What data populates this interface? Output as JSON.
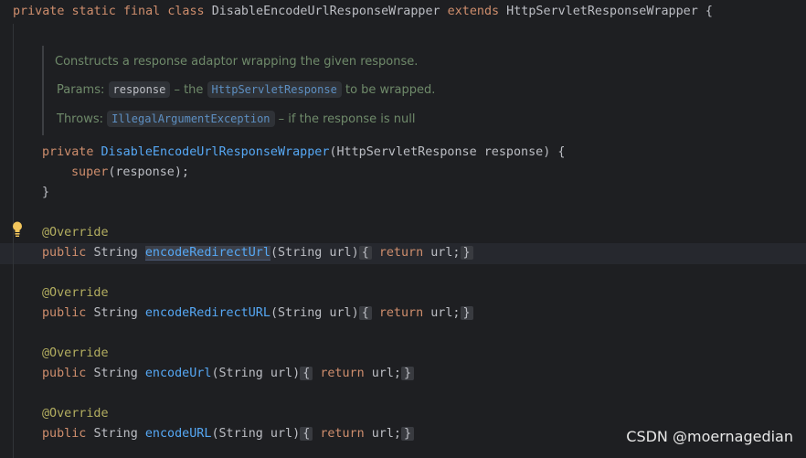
{
  "code": {
    "class_decl": {
      "private": "private",
      "static": "static",
      "final": "final",
      "class": "class",
      "name": "DisableEncodeUrlResponseWrapper",
      "extends": "extends",
      "parent": "HttpServletResponseWrapper",
      "brace": "{"
    },
    "javadoc": {
      "summary": "Constructs a response adaptor wrapping the given response.",
      "params_label": "Params:",
      "param_name": "response",
      "param_dash": "– the",
      "param_type": "HttpServletResponse",
      "param_tail": "to be wrapped.",
      "throws_label": "Throws:",
      "throws_type": "IllegalArgumentException",
      "throws_tail": "– if the response is null"
    },
    "constructor": {
      "modifier": "private",
      "name": "DisableEncodeUrlResponseWrapper",
      "params_open": "(HttpServletResponse response) {",
      "super_kw": "super",
      "super_args": "(response);",
      "close": "}"
    },
    "methods": [
      {
        "annotation": "@Override",
        "modifier": "public",
        "type": "String",
        "name": "encodeRedirectUrl",
        "params": "(String url)",
        "fold_open": "{",
        "return_kw": "return",
        "body": "url;",
        "fold_close": "}"
      },
      {
        "annotation": "@Override",
        "modifier": "public",
        "type": "String",
        "name": "encodeRedirectURL",
        "params": "(String url)",
        "fold_open": "{",
        "return_kw": "return",
        "body": "url;",
        "fold_close": "}"
      },
      {
        "annotation": "@Override",
        "modifier": "public",
        "type": "String",
        "name": "encodeUrl",
        "params": "(String url)",
        "fold_open": "{",
        "return_kw": "return",
        "body": "url;",
        "fold_close": "}"
      },
      {
        "annotation": "@Override",
        "modifier": "public",
        "type": "String",
        "name": "encodeURL",
        "params": "(String url)",
        "fold_open": "{",
        "return_kw": "return",
        "body": "url;",
        "fold_close": "}"
      }
    ]
  },
  "gutter": {
    "intention_icon": "lightbulb-icon"
  },
  "watermark": "CSDN @moernagedian",
  "colors": {
    "background": "#1e1f22",
    "keyword": "#cf8e6d",
    "method_name": "#56a8f5",
    "annotation": "#b3ae60",
    "doc_text": "#6f8a6a"
  }
}
